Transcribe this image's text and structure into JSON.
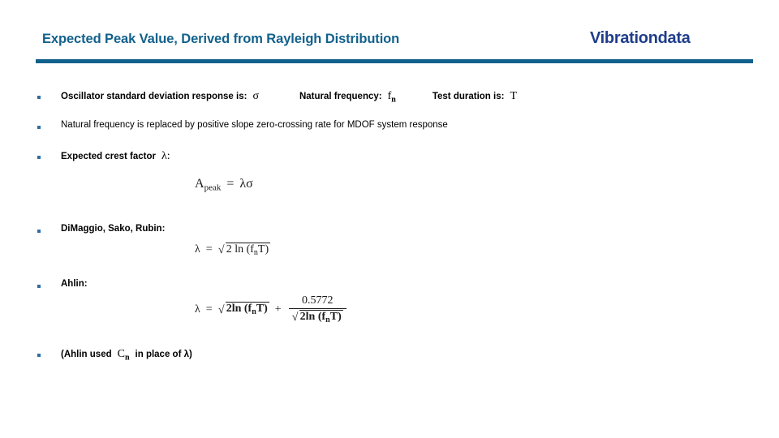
{
  "header": {
    "title": "Expected Peak Value, Derived from Rayleigh Distribution",
    "brand": "Vibrationdata",
    "title_color": "#12618C",
    "brand_color": "#1F3D8C",
    "rule_color": "#12618C"
  },
  "bullets": [
    {
      "id": "oscillator-sigma",
      "label_1": "Oscillator standard deviation response is:",
      "symbol_1": "σ",
      "label_2": "Natural frequency:",
      "symbol_2_base": "f",
      "symbol_2_sub": "n",
      "label_3": "Test duration is:",
      "symbol_3": "T",
      "bold": true
    },
    {
      "id": "natural-frequency-replacement",
      "text": "Natural frequency is replaced by positive slope zero-crossing rate for MDOF system response",
      "bold": false
    },
    {
      "id": "expected-crest-factor",
      "text": "Expected crest factor",
      "symbol": "λ:",
      "bold": true
    },
    {
      "id": "dimaggio-sako-rubin",
      "text": "DiMaggio, Sako, Rubin:",
      "bold": true
    },
    {
      "id": "ahlin",
      "text": "Ahlin:",
      "bold": true
    },
    {
      "id": "ahlin-note",
      "text_pre": "(Ahlin used",
      "symbol_base": "C",
      "symbol_sub": "n",
      "text_post": "in place of λ)",
      "bold": true
    }
  ],
  "equations": {
    "a_peak": {
      "lhs_base": "A",
      "lhs_sub": "peak",
      "rel": "=",
      "rhs": "λσ",
      "plain": "A_peak = λσ"
    },
    "dimaggio": {
      "lhs": "λ",
      "rel": "=",
      "radical": "√",
      "radicand_pre": "2 ln (f",
      "radicand_sub": "n",
      "radicand_post": "T)",
      "plain": "λ = √(2 ln(f_n T))"
    },
    "ahlin": {
      "lhs": "λ",
      "rel": "=",
      "term1_pre": "2ln (f",
      "term1_sub": "n",
      "term1_post": "T)",
      "plus": "+",
      "numerator": "0.5772",
      "den_pre": "2ln (f",
      "den_sub": "n",
      "den_post": "T)",
      "radical": "√",
      "plain": "λ = √(2ln(f_n T)) + 0.5772 / √(2ln(f_n T))"
    }
  }
}
